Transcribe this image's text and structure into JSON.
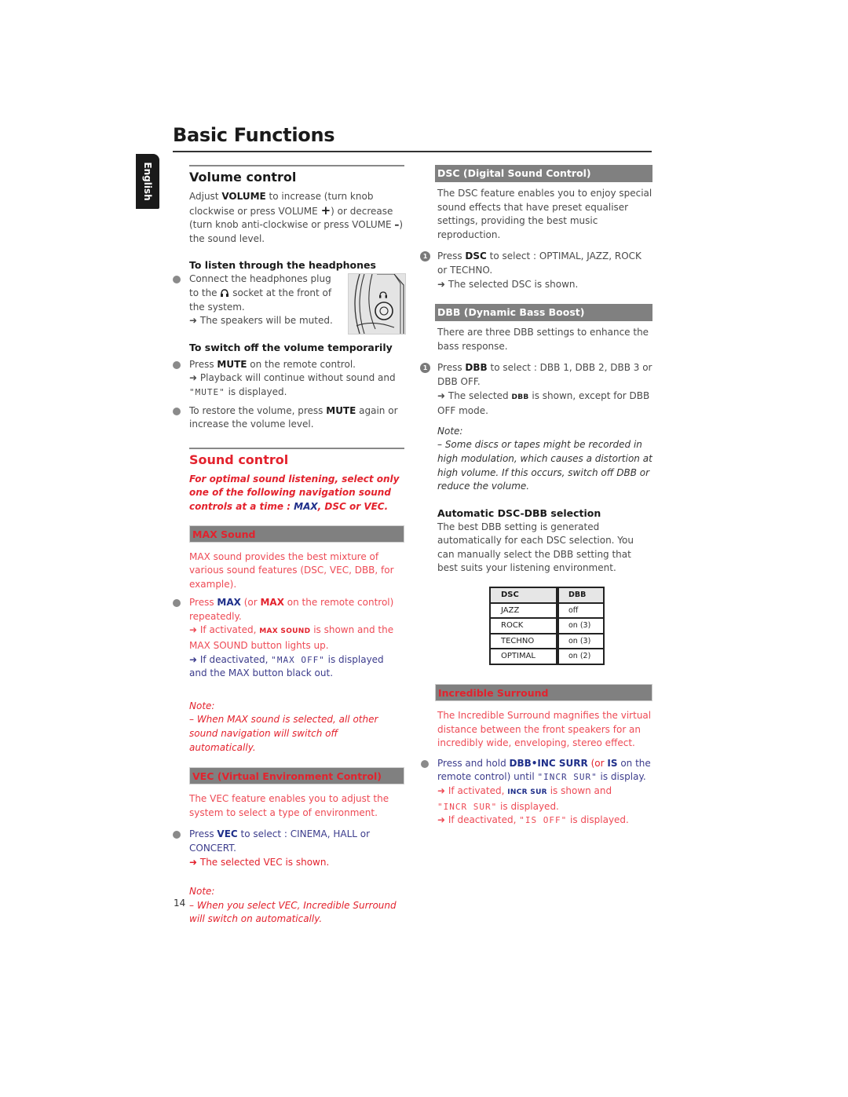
{
  "page": {
    "title": "Basic Functions",
    "language_tab": "English",
    "page_number": "14"
  },
  "colors": {
    "heading_red": "#e3222d",
    "body_pink": "#ee4a55",
    "body_blue": "#3c3c8c",
    "bar_grey": "#808080",
    "text_grey": "#4a4a4a"
  },
  "volume": {
    "heading": "Volume control",
    "intro": {
      "p1": "Adjust ",
      "b1": "VOLUME",
      "p2": " to increase (turn knob clockwise or press VOLUME ",
      "plus": "+",
      "p3": ") or decrease (turn knob anti-clockwise or press VOLUME ",
      "minus": "–",
      "p4": ") the sound level."
    },
    "headphones": {
      "heading": "To listen through the headphones",
      "t1": "Connect the headphones plug to the ",
      "icon": "headphones-icon",
      "t2": " socket at the front of the system.",
      "result": "➜ The speakers will be muted."
    },
    "mute": {
      "heading": "To switch off the volume temporarily",
      "b1_pre": "Press ",
      "b1_key": "MUTE",
      "b1_post": " on the remote control.",
      "b1_result_pre": "➜ Playback will continue without sound and ",
      "b1_display": "\"MUTE\"",
      "b1_result_post": " is displayed.",
      "b2_pre": "To restore the volume, press ",
      "b2_key": "MUTE",
      "b2_post": " again or increase the volume level."
    }
  },
  "sound": {
    "heading": "Sound control",
    "intro_pre": "For optimal sound listening, select only one of the following navigation sound controls at a time : ",
    "intro_max": "MAX",
    "intro_post": ", DSC or VEC.",
    "max": {
      "bar": "MAX Sound",
      "desc": "MAX sound provides the best mixture of various sound features (DSC, VEC, DBB, for example).",
      "s_press": "Press ",
      "s_key1": "MAX",
      "s_or": " (or ",
      "s_key2": "MAX",
      "s_post": " on the remote control) repeatedly.",
      "act_pre": "➜ If activated, ",
      "act_lcd": "MAX SOUND",
      "act_post": " is shown and the MAX SOUND button lights up.",
      "deact_pre": "➜ If deactivated, ",
      "deact_lcd": "\"MAX OFF\"",
      "deact_post": " is displayed and the MAX button black out.",
      "note_label": "Note:",
      "note_text": "–  When MAX sound is selected, all other sound navigation will switch off automatically."
    },
    "vec": {
      "bar": "VEC (Virtual Environment Control)",
      "desc": "The VEC feature enables you to adjust the system to select a type of environment.",
      "s_pre": "Press ",
      "s_key": "VEC",
      "s_post": " to select : CINEMA, HALL or CONCERT.",
      "result": "➜ The selected VEC is shown.",
      "note_label": "Note:",
      "note_text": "–  When you select VEC, Incredible Surround will switch on automatically."
    }
  },
  "dsc": {
    "bar": "DSC (Digital Sound Control)",
    "desc": "The DSC feature enables you to enjoy special sound effects that have preset equaliser settings, providing the best music reproduction.",
    "step_num": "1",
    "s_pre": "Press ",
    "s_key": "DSC",
    "s_post": " to select : OPTIMAL, JAZZ, ROCK or TECHNO.",
    "result": "➜ The selected DSC is shown."
  },
  "dbb": {
    "bar": "DBB (Dynamic Bass Boost)",
    "desc": "There are three DBB settings to enhance the bass response.",
    "step_num": "1",
    "s_pre": "Press ",
    "s_key": "DBB",
    "s_post": " to select : DBB 1, DBB 2, DBB 3 or DBB OFF.",
    "res_pre": "➜ The selected ",
    "res_lcd": "DBB",
    "res_post": " is shown, except for DBB OFF mode.",
    "note_label": "Note:",
    "note_text": "–  Some discs or tapes might be recorded in high modulation, which causes a distortion at high volume. If this occurs, switch off DBB or reduce the volume."
  },
  "auto": {
    "heading": "Automatic DSC-DBB selection",
    "desc": "The best DBB setting is generated automatically for each DSC selection. You can manually select the DBB setting that best suits your listening environment.",
    "table": {
      "headers": [
        "DSC",
        "DBB"
      ],
      "rows": [
        [
          "JAZZ",
          "off"
        ],
        [
          "ROCK",
          "on (3)"
        ],
        [
          "TECHNO",
          "on (3)"
        ],
        [
          "OPTIMAL",
          "on (2)"
        ]
      ]
    }
  },
  "incredible": {
    "bar": "Incredible Surround",
    "desc": "The Incredible Surround magnifies the virtual distance between the front speakers for an incredibly wide, enveloping, stereo effect.",
    "s_pre": "Press and hold ",
    "s_key": "DBB•INC SURR",
    "s_or": " (or ",
    "s_key2": "IS",
    "s_post": " on the remote control) until ",
    "s_lcd": "\"INCR SUR\"",
    "s_end": " is display.",
    "act_pre": "➜ If activated, ",
    "act_lcd": "INCR SUR",
    "act_mid": " is shown and ",
    "act_lcd2": "\"INCR SUR\"",
    "act_post": " is displayed.",
    "deact_pre": "➜ If deactivated, ",
    "deact_lcd": "\"IS OFF\"",
    "deact_post": " is displayed."
  }
}
